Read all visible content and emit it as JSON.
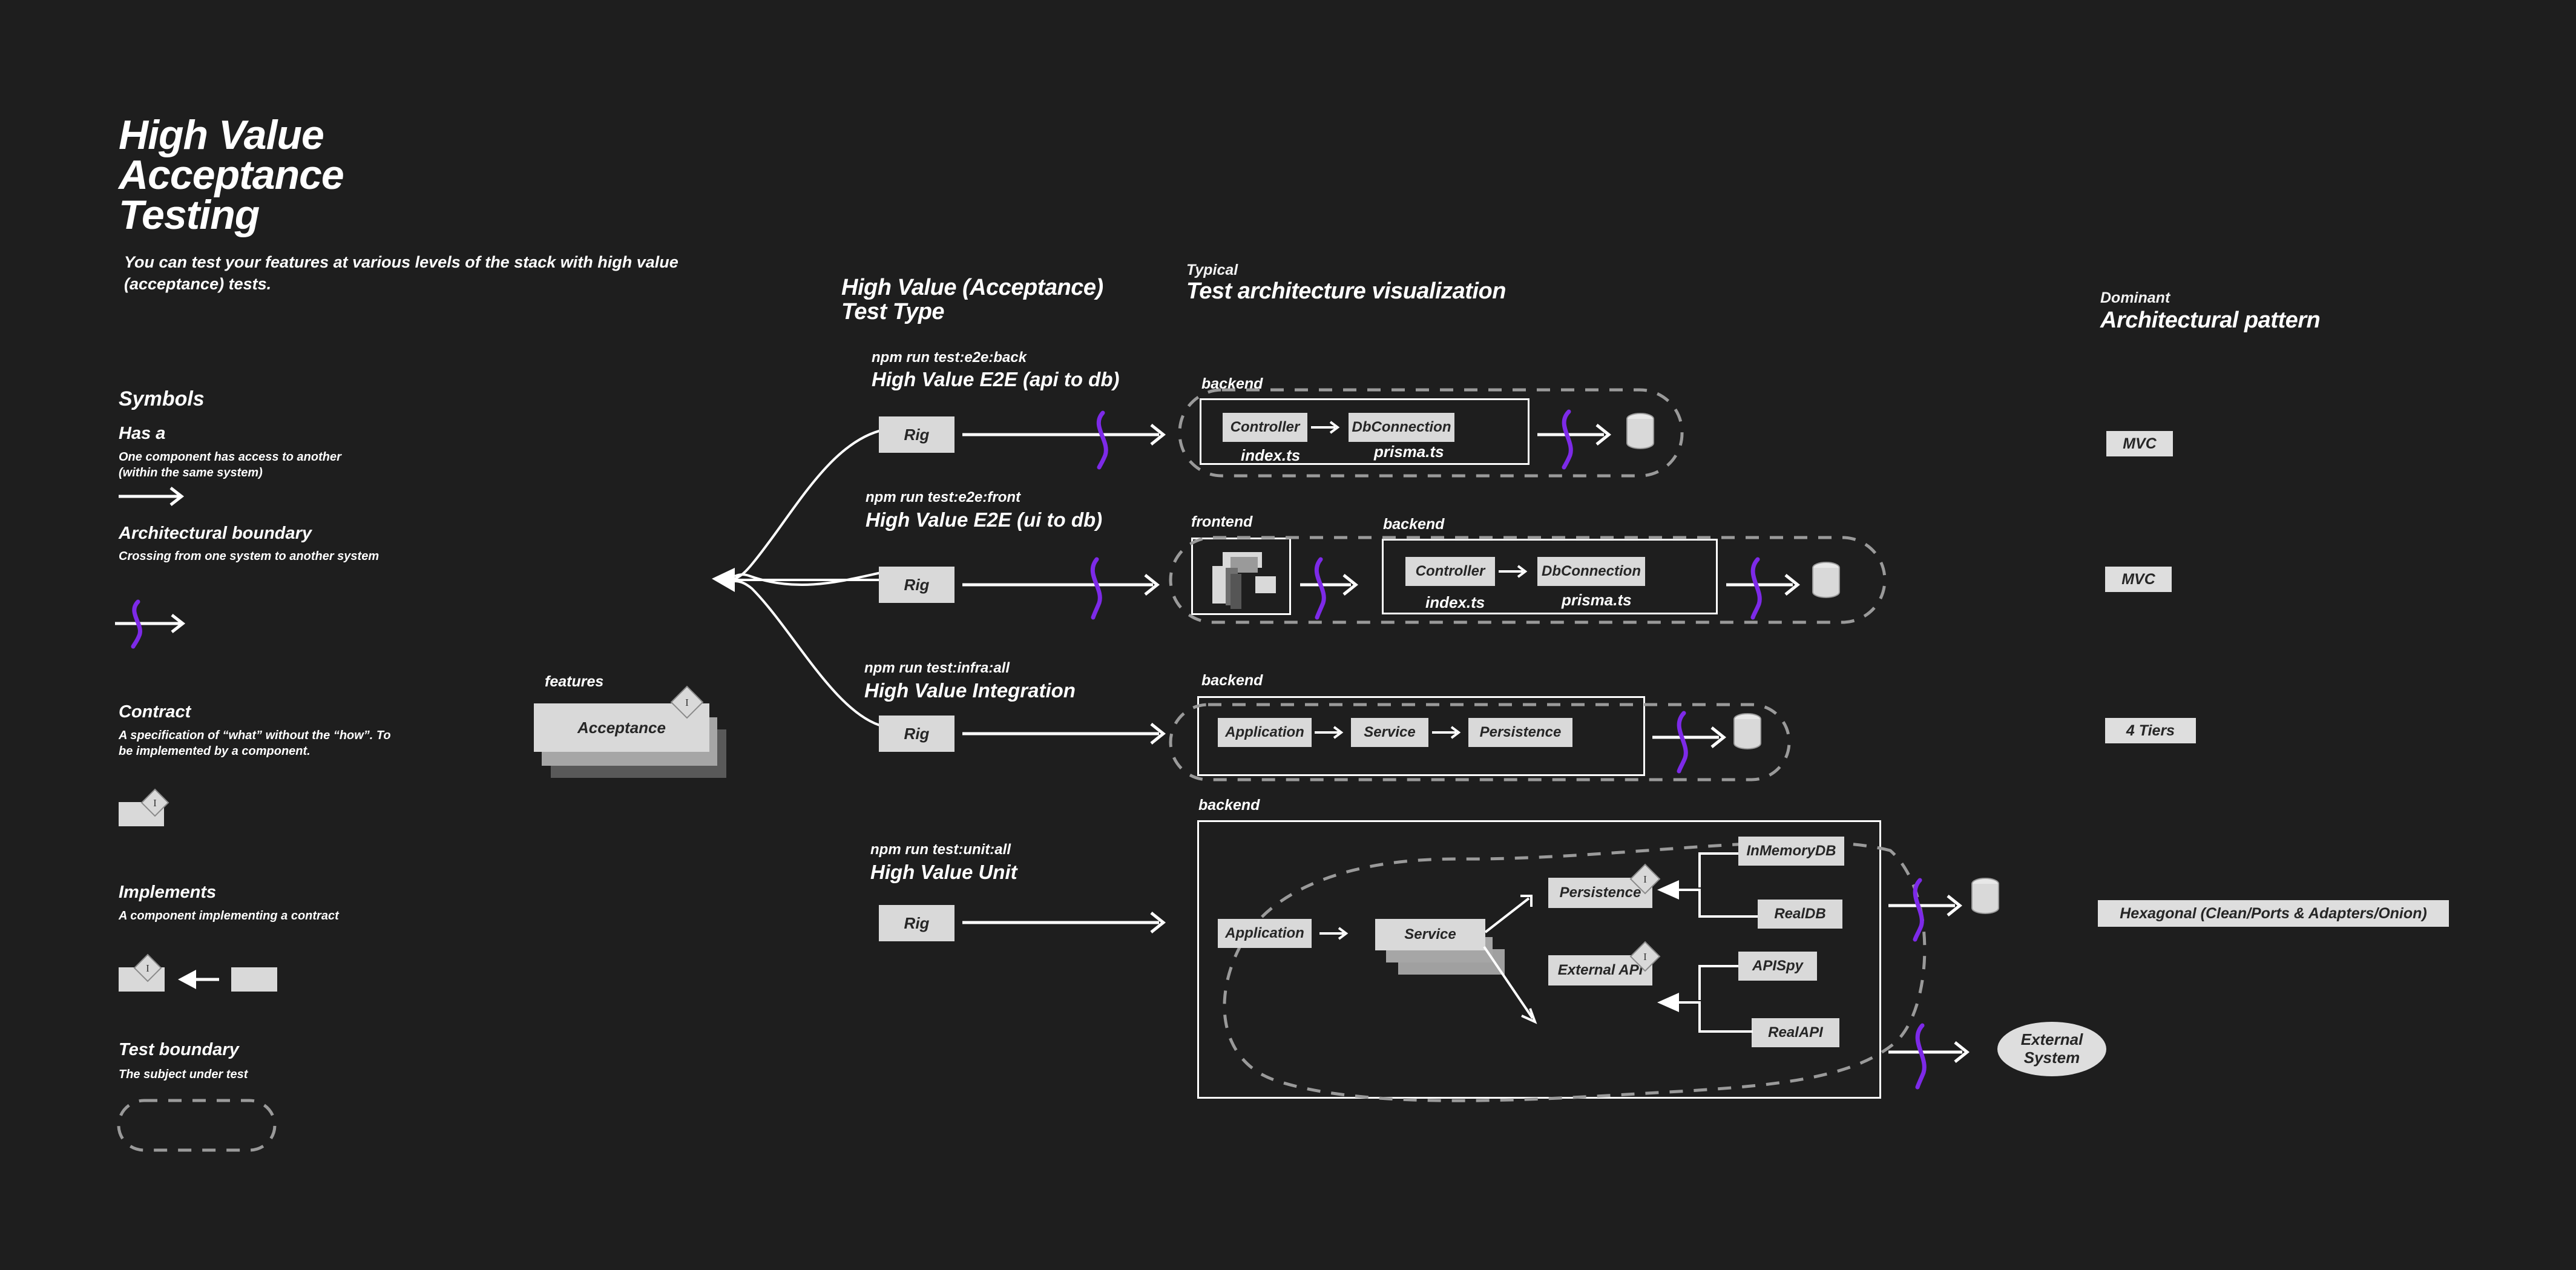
{
  "title": "High Value\nAcceptance\nTesting",
  "title_lines": [
    "High Value",
    "Acceptance",
    "Testing"
  ],
  "subtitle": "You can test your features at various levels of the stack with high value (acceptance) tests.",
  "colors": {
    "background": "#1e1e1e",
    "box_fill": "#d9d9d9",
    "box_text": "#262626",
    "boundary_purple": "#7d2ae8",
    "dashed_grey": "#9a9a9a",
    "white": "#ffffff"
  },
  "legend": {
    "heading": "Symbols",
    "items": [
      {
        "title": "Has a",
        "desc": "One component has access to another (within the same system)",
        "symbol": "plain-arrow-icon"
      },
      {
        "title": "Architectural boundary",
        "desc": "Crossing from one system to another system",
        "symbol": "boundary-arrow-icon"
      },
      {
        "title": "Contract",
        "desc": "A specification of “what” without the “how”. To be implemented by a component.",
        "symbol": "contract-box-icon"
      },
      {
        "title": "Implements",
        "desc": "A component implementing a contract",
        "symbol": "implements-arrow-icon"
      },
      {
        "title": "Test boundary",
        "desc": "The subject under test",
        "symbol": "test-boundary-icon"
      }
    ],
    "interface_marker": "I"
  },
  "hub": {
    "namespace": "features",
    "label": "Acceptance",
    "interface_marker": "I"
  },
  "columns": {
    "test_type": {
      "kicker": "",
      "title": "High Value (Acceptance)\nTest Type",
      "title_lines": [
        "High Value (Acceptance)",
        "Test Type"
      ]
    },
    "visualization": {
      "kicker": "Typical",
      "title": "Test architecture visualization"
    },
    "pattern": {
      "kicker": "Dominant",
      "title": "Architectural pattern"
    }
  },
  "rows": [
    {
      "command": "npm run test:e2e:back",
      "type": "High Value E2E (api to db)",
      "rig": "Rig",
      "pattern": "MVC",
      "systems": [
        {
          "label": "backend",
          "components": [
            "Controller",
            "DbConnection"
          ],
          "files": [
            "index.ts",
            "prisma.ts"
          ]
        }
      ],
      "datastore": "database-cylinder-icon"
    },
    {
      "command": "npm run test:e2e:front",
      "type": "High Value E2E (ui to db)",
      "rig": "Rig",
      "pattern": "MVC",
      "systems": [
        {
          "label": "frontend",
          "components": [],
          "files": []
        },
        {
          "label": "backend",
          "components": [
            "Controller",
            "DbConnection"
          ],
          "files": [
            "index.ts",
            "prisma.ts"
          ]
        }
      ],
      "datastore": "database-cylinder-icon"
    },
    {
      "command": "npm run test:infra:all",
      "type": "High Value Integration",
      "rig": "Rig",
      "pattern": "4 Tiers",
      "systems": [
        {
          "label": "backend",
          "components": [
            "Application",
            "Service",
            "Persistence"
          ],
          "files": []
        }
      ],
      "datastore": "database-cylinder-icon"
    },
    {
      "command": "npm run test:unit:all",
      "type": "High Value Unit",
      "rig": "Rig",
      "pattern": "Hexagonal (Clean/Ports & Adapters/Onion)",
      "systems": [
        {
          "label": "backend",
          "components": [
            "Application",
            "Service",
            "Persistence",
            "External API",
            "InMemoryDB",
            "RealDB",
            "APISpy",
            "RealAPI"
          ],
          "files": []
        }
      ],
      "datastore": "database-cylinder-icon",
      "external_system": "External System"
    }
  ]
}
